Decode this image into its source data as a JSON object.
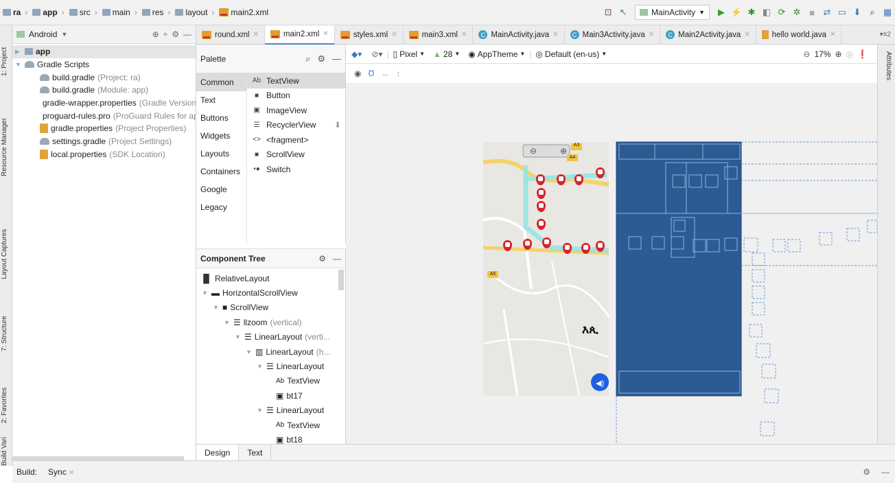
{
  "breadcrumb": [
    "ra",
    "app",
    "src",
    "main",
    "res",
    "layout",
    "main2.xml"
  ],
  "toolbar": {
    "run_config": "MainActivity"
  },
  "left_strip": [
    "1: Project",
    "Resource Manager",
    "Layout Captures",
    "7: Structure",
    "2: Favorites",
    "Build Variants"
  ],
  "project": {
    "view": "Android",
    "items": [
      {
        "name": "app",
        "detail": ""
      },
      {
        "name": "Gradle Scripts",
        "detail": ""
      },
      {
        "name": "build.gradle",
        "detail": "(Project: ra)"
      },
      {
        "name": "build.gradle",
        "detail": "(Module: app)"
      },
      {
        "name": "gradle-wrapper.properties",
        "detail": "(Gradle Version"
      },
      {
        "name": "proguard-rules.pro",
        "detail": "(ProGuard Rules for ap"
      },
      {
        "name": "gradle.properties",
        "detail": "(Project Properties)"
      },
      {
        "name": "settings.gradle",
        "detail": "(Project Settings)"
      },
      {
        "name": "local.properties",
        "detail": "(SDK Location)"
      }
    ]
  },
  "tabs": [
    "round.xml",
    "main2.xml",
    "styles.xml",
    "main3.xml",
    "MainActivity.java",
    "Main3Activity.java",
    "Main2Activity.java",
    "hello world.java"
  ],
  "palette": {
    "title": "Palette",
    "categories": [
      "Common",
      "Text",
      "Buttons",
      "Widgets",
      "Layouts",
      "Containers",
      "Google",
      "Legacy"
    ],
    "items": [
      {
        "icon": "Ab",
        "label": "TextView"
      },
      {
        "icon": "■",
        "label": "Button"
      },
      {
        "icon": "▣",
        "label": "ImageView"
      },
      {
        "icon": "☰",
        "label": "RecyclerView"
      },
      {
        "icon": "<>",
        "label": "<fragment>"
      },
      {
        "icon": "■",
        "label": "ScrollView"
      },
      {
        "icon": "•●",
        "label": "Switch"
      }
    ]
  },
  "component_tree": {
    "title": "Component Tree",
    "rows": [
      {
        "label": "RelativeLayout",
        "detail": ""
      },
      {
        "label": "HorizontalScrollView",
        "detail": ""
      },
      {
        "label": "ScrollView",
        "detail": ""
      },
      {
        "label": "llzoom",
        "detail": "(vertical)"
      },
      {
        "label": "LinearLayout",
        "detail": "(verti..."
      },
      {
        "label": "LinearLayout",
        "detail": "(h..."
      },
      {
        "label": "LinearLayout",
        "detail": ""
      },
      {
        "label": "TextView",
        "detail": ""
      },
      {
        "label": "bt17",
        "detail": ""
      },
      {
        "label": "LinearLayout",
        "detail": ""
      },
      {
        "label": "TextView",
        "detail": ""
      },
      {
        "label": "bt18",
        "detail": ""
      }
    ]
  },
  "design_toolbar": {
    "device": "Pixel",
    "api": "28",
    "theme": "AppTheme",
    "locale": "Default (en-us)",
    "zoom": "17%"
  },
  "map": {
    "road_labels": [
      "A3",
      "A4",
      "A5"
    ],
    "overlay_text": "እጲ"
  },
  "bottom_tabs": [
    "Design",
    "Text"
  ],
  "build_bar": {
    "label": "Build:",
    "tab": "Sync"
  },
  "attributes_label": "Attributes"
}
